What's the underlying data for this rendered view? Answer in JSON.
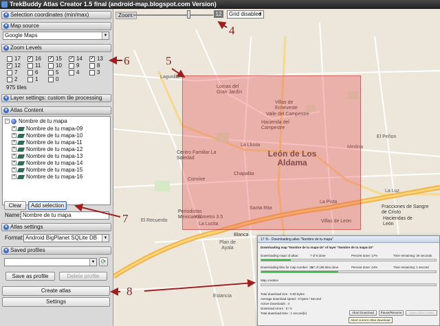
{
  "window": {
    "title": "TrekBuddy Atlas Creator 1.5 final (android-map.blogspot.com Version)"
  },
  "left": {
    "sections": {
      "selection": "Selection coordinates (min/max)",
      "map_source": "Map source",
      "zoom_levels": "Zoom Levels",
      "layer_settings": "Layer settings: custom tile processing",
      "atlas_content": "Atlas Content",
      "atlas_settings": "Atlas settings",
      "saved_profiles": "Saved profiles"
    },
    "map_source_value": "Google Maps",
    "zoom_levels": [
      {
        "level": "17",
        "checked": false
      },
      {
        "level": "16",
        "checked": true
      },
      {
        "level": "15",
        "checked": true
      },
      {
        "level": "14",
        "checked": true
      },
      {
        "level": "13",
        "checked": true
      },
      {
        "level": "12",
        "checked": true
      },
      {
        "level": "11",
        "checked": false
      },
      {
        "level": "10",
        "checked": false
      },
      {
        "level": "9",
        "checked": false
      },
      {
        "level": "8",
        "checked": false
      },
      {
        "level": "7",
        "checked": false
      },
      {
        "level": "6",
        "checked": false
      },
      {
        "level": "5",
        "checked": false
      },
      {
        "level": "4",
        "checked": false
      },
      {
        "level": "3",
        "checked": false
      },
      {
        "level": "2",
        "checked": false
      },
      {
        "level": "1",
        "checked": false
      },
      {
        "level": "0",
        "checked": false
      }
    ],
    "tiles_count": "975 tiles",
    "atlas_tree": {
      "root": "Nombre de tu mapa",
      "layers": [
        "Nombre de tu mapa-09",
        "Nombre de tu mapa-10",
        "Nombre de tu mapa-11",
        "Nombre de tu mapa-12",
        "Nombre de tu mapa-13",
        "Nombre de tu mapa-14",
        "Nombre de tu mapa-15",
        "Nombre de tu mapa-16"
      ]
    },
    "clear_button": "Clear",
    "add_selection_button": "Add selection",
    "name_label": "Name:",
    "name_value": "Nombre de tu mapa",
    "format_label": "Format:",
    "format_value": "Android BigPlanet SQLite DB",
    "save_profile_button": "Save as profile",
    "delete_profile_button": "Delete profile",
    "create_atlas_button": "Create atlas",
    "settings_button": "Settings"
  },
  "map": {
    "zoom_label": "Zoom:",
    "zoom_value": "12",
    "zoom_slider_fraction": 0.7,
    "grid_select": "Grid disabled",
    "labels": {
      "lagunilla": "Lagunilla",
      "lomas_gran_jardin": "Lomas del Gran Jardín",
      "villas_echeveste": "Villas de Echeveste",
      "valle_del_campestre": "Valle del Campestre",
      "hacienda_campestre": "Hacienda del Campestre",
      "centro_familiar": "Centro Familiar La Soledad",
      "leon": "León de Los Aldama",
      "la_lluvia": "La Lluvia",
      "medina": "Medina",
      "el_penon": "El Peñon",
      "convive": "Convive",
      "chapalita": "Chapalita",
      "la_luz": "La Luz",
      "la_pista": "La Pista",
      "periodistas": "Periodistas Mexicanos",
      "kilometro": "Kilómetro 3.5",
      "santa_rita": "Santa Rita",
      "el_recuerdo": "El Recuerdo",
      "la_lucita": "La Lucita",
      "plan_de_ayala": "Plan de Ayala",
      "blanca": "Blanca",
      "estancia": "Estancia",
      "villas_de_leon": "Villas de León",
      "fracciones": "Fracciones de Sangre de Cristo",
      "haciendas": "Haciendas de León"
    }
  },
  "annotations": [
    "4",
    "5",
    "6",
    "7",
    "8"
  ],
  "download_dialog": {
    "title": "17 % - Downloading atlas \"Nombre de tu mapa\"",
    "header": "Downloading map \"Nombre de tu mapa-15\" of layer \"Nombre de tu mapa-15\"",
    "maps_label": "Downloading maps of atlas:",
    "maps_done": "7 of 8 done",
    "maps_percent": "Percent done: 17%",
    "time_remaining": "Time remaining: 26 seconds",
    "maps_progress": 0.17,
    "tiles_label": "Downloading tiles for map number: 15",
    "tiles_done": "87 of 195 tiles done",
    "tiles_percent": "Percent done: 44%",
    "time_remaining2": "Time remaining: 1 second",
    "tiles_progress": 0.44,
    "map_creation": "Map creation",
    "stats": [
      "Total download size : 0.00 bytes",
      "Average download speed : 0 bytes / Second",
      "Active Downloads : 4",
      "Download errors : 0 / 0",
      "Total download time : 1 second(s)"
    ],
    "abort_button": "Abort Download",
    "pause_button": "Pause/Resume",
    "open_folder_button": "Open Atlas Folder",
    "tooltip": "Abort current Atlas download"
  }
}
